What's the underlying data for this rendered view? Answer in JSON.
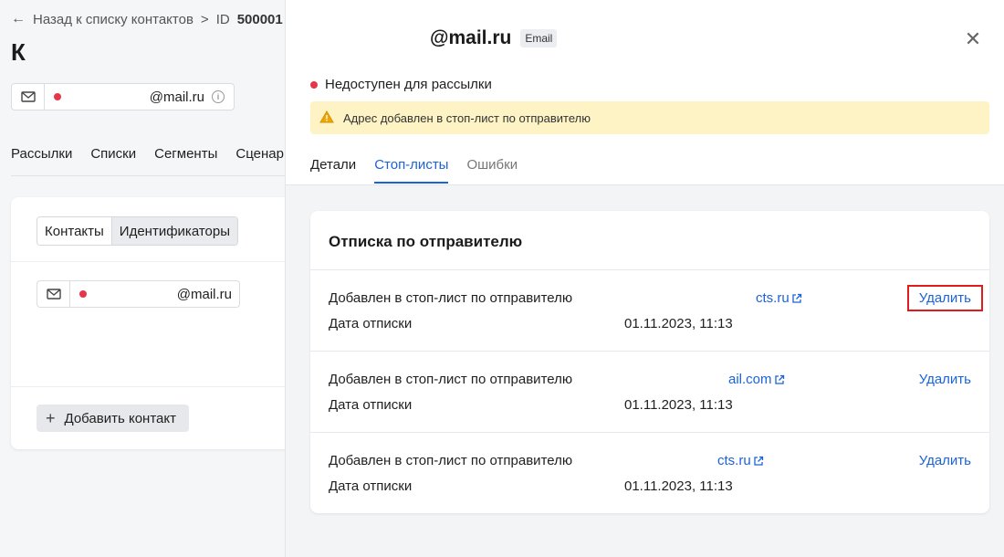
{
  "left": {
    "breadcrumb_back": "Назад к списку контактов",
    "breadcrumb_id_label": "ID",
    "breadcrumb_id_value": "500001",
    "title": "К",
    "contact_email": "@mail.ru",
    "tabs": [
      "Рассылки",
      "Списки",
      "Сегменты",
      "Сценар"
    ],
    "segment": {
      "contacts": "Контакты",
      "identifiers": "Идентификаторы"
    },
    "card_email": "@mail.ru",
    "add_contact": "Добавить контакт"
  },
  "drawer": {
    "email": "@mail.ru",
    "badge": "Email",
    "status": "Недоступен для рассылки",
    "alert": "Адрес добавлен в стоп-лист по отправителю",
    "tabs": {
      "details": "Детали",
      "stoplists": "Стоп-листы",
      "errors": "Ошибки"
    },
    "card_title": "Отписка по отправителю",
    "rows": [
      {
        "label": "Добавлен в стоп-лист по отправителю",
        "link": "cts.ru",
        "date_label": "Дата отписки",
        "date": "01.11.2023, 11:13",
        "delete": "Удалить"
      },
      {
        "label": "Добавлен в стоп-лист по отправителю",
        "link": "ail.com",
        "date_label": "Дата отписки",
        "date": "01.11.2023, 11:13",
        "delete": "Удалить"
      },
      {
        "label": "Добавлен в стоп-лист по отправителю",
        "link": "cts.ru",
        "date_label": "Дата отписки",
        "date": "01.11.2023, 11:13",
        "delete": "Удалить"
      }
    ]
  },
  "colors": {
    "accent": "#1a63d8",
    "status_red": "#e5364a",
    "alert_bg": "#fdf3c4",
    "highlight": "#e01b1b"
  },
  "icons": [
    "back-arrow-icon",
    "mail-icon",
    "info-icon",
    "close-icon",
    "warning-icon",
    "external-link-icon",
    "plus-icon"
  ]
}
